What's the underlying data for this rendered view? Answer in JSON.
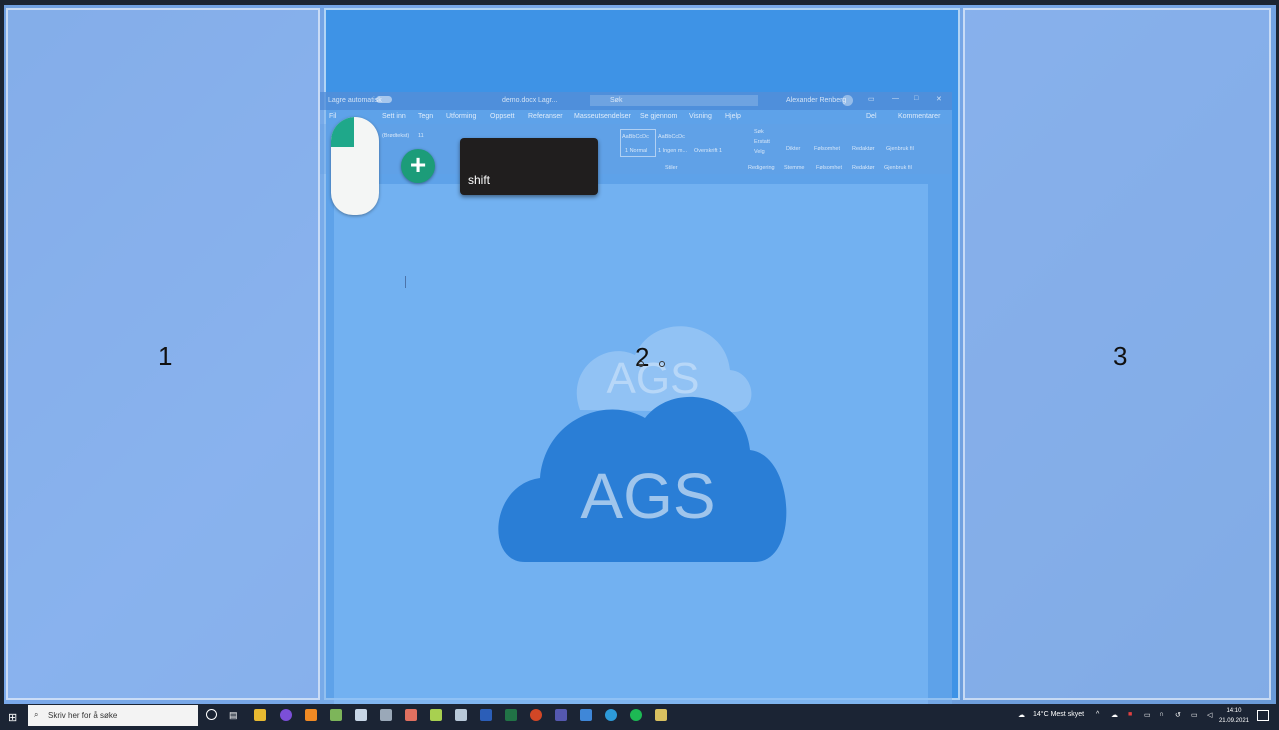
{
  "zones": {
    "z1": "1",
    "z2": "2",
    "z3": "3"
  },
  "overlay": {
    "key_label": "shift",
    "mouse_button": "left",
    "modifier_symbol": "+"
  },
  "word": {
    "autosave": "Lagre automatisk",
    "doc_title": "demo.docx",
    "save_state": "Lagr...",
    "search_placeholder": "Søk",
    "user": "Alexander Renberg",
    "menu": [
      "Fil",
      "Sett inn",
      "Tegn",
      "Utforming",
      "Oppsett",
      "Referanser",
      "Masseutsendelser",
      "Se gjennom",
      "Visning",
      "Hjelp"
    ],
    "share": "Del",
    "comments": "Kommentarer",
    "font": "(Brødtekst)",
    "size": "11",
    "styles": [
      "1 Normal",
      "1 Ingen m...",
      "Overskrift 1"
    ],
    "style_sample": "AaBbCcDc",
    "group_style": "Stiler",
    "find": "Søk",
    "replace": "Erstatt",
    "select": "Velg",
    "group_edit": "Redigering",
    "dictate": "Dikter",
    "group_voice": "Stemme",
    "sensitivity": "Følsomhet",
    "editor": "Redaktør",
    "group_editor": "Redaktør",
    "reuse": "Gjenbruk fil",
    "group_reuse": "Gjenbruk fil"
  },
  "logo": {
    "text_top": "AGS",
    "text_bottom": "AGS"
  },
  "taskbar": {
    "search_placeholder": "Skriv her for å søke",
    "weather": "14°C  Mest skyet",
    "time": "14:10",
    "date": "21.09.2021"
  },
  "colors": {
    "accent_zone": "#3e93e6",
    "mouse_accent": "#1fa88a",
    "plus": "#1c9c79"
  }
}
